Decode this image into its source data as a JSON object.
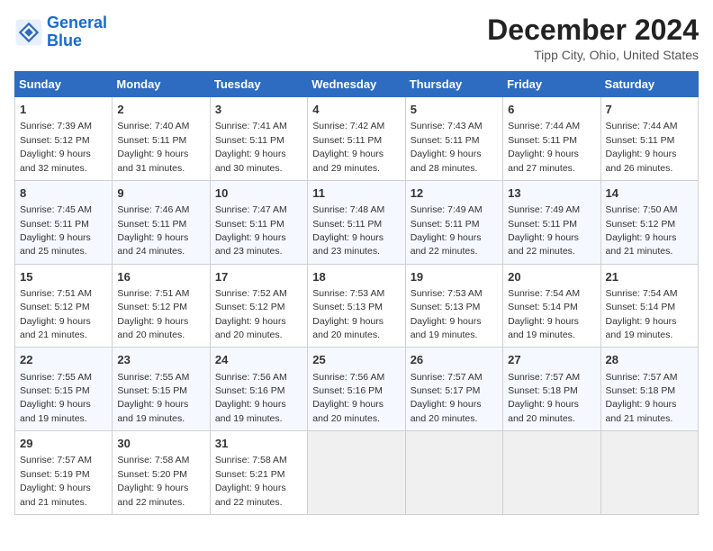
{
  "header": {
    "logo_line1": "General",
    "logo_line2": "Blue",
    "title": "December 2024",
    "subtitle": "Tipp City, Ohio, United States"
  },
  "days_of_week": [
    "Sunday",
    "Monday",
    "Tuesday",
    "Wednesday",
    "Thursday",
    "Friday",
    "Saturday"
  ],
  "weeks": [
    [
      {
        "day": "1",
        "sunrise": "7:39 AM",
        "sunset": "5:12 PM",
        "daylight": "9 hours and 32 minutes."
      },
      {
        "day": "2",
        "sunrise": "7:40 AM",
        "sunset": "5:11 PM",
        "daylight": "9 hours and 31 minutes."
      },
      {
        "day": "3",
        "sunrise": "7:41 AM",
        "sunset": "5:11 PM",
        "daylight": "9 hours and 30 minutes."
      },
      {
        "day": "4",
        "sunrise": "7:42 AM",
        "sunset": "5:11 PM",
        "daylight": "9 hours and 29 minutes."
      },
      {
        "day": "5",
        "sunrise": "7:43 AM",
        "sunset": "5:11 PM",
        "daylight": "9 hours and 28 minutes."
      },
      {
        "day": "6",
        "sunrise": "7:44 AM",
        "sunset": "5:11 PM",
        "daylight": "9 hours and 27 minutes."
      },
      {
        "day": "7",
        "sunrise": "7:44 AM",
        "sunset": "5:11 PM",
        "daylight": "9 hours and 26 minutes."
      }
    ],
    [
      {
        "day": "8",
        "sunrise": "7:45 AM",
        "sunset": "5:11 PM",
        "daylight": "9 hours and 25 minutes."
      },
      {
        "day": "9",
        "sunrise": "7:46 AM",
        "sunset": "5:11 PM",
        "daylight": "9 hours and 24 minutes."
      },
      {
        "day": "10",
        "sunrise": "7:47 AM",
        "sunset": "5:11 PM",
        "daylight": "9 hours and 23 minutes."
      },
      {
        "day": "11",
        "sunrise": "7:48 AM",
        "sunset": "5:11 PM",
        "daylight": "9 hours and 23 minutes."
      },
      {
        "day": "12",
        "sunrise": "7:49 AM",
        "sunset": "5:11 PM",
        "daylight": "9 hours and 22 minutes."
      },
      {
        "day": "13",
        "sunrise": "7:49 AM",
        "sunset": "5:11 PM",
        "daylight": "9 hours and 22 minutes."
      },
      {
        "day": "14",
        "sunrise": "7:50 AM",
        "sunset": "5:12 PM",
        "daylight": "9 hours and 21 minutes."
      }
    ],
    [
      {
        "day": "15",
        "sunrise": "7:51 AM",
        "sunset": "5:12 PM",
        "daylight": "9 hours and 21 minutes."
      },
      {
        "day": "16",
        "sunrise": "7:51 AM",
        "sunset": "5:12 PM",
        "daylight": "9 hours and 20 minutes."
      },
      {
        "day": "17",
        "sunrise": "7:52 AM",
        "sunset": "5:12 PM",
        "daylight": "9 hours and 20 minutes."
      },
      {
        "day": "18",
        "sunrise": "7:53 AM",
        "sunset": "5:13 PM",
        "daylight": "9 hours and 20 minutes."
      },
      {
        "day": "19",
        "sunrise": "7:53 AM",
        "sunset": "5:13 PM",
        "daylight": "9 hours and 19 minutes."
      },
      {
        "day": "20",
        "sunrise": "7:54 AM",
        "sunset": "5:14 PM",
        "daylight": "9 hours and 19 minutes."
      },
      {
        "day": "21",
        "sunrise": "7:54 AM",
        "sunset": "5:14 PM",
        "daylight": "9 hours and 19 minutes."
      }
    ],
    [
      {
        "day": "22",
        "sunrise": "7:55 AM",
        "sunset": "5:15 PM",
        "daylight": "9 hours and 19 minutes."
      },
      {
        "day": "23",
        "sunrise": "7:55 AM",
        "sunset": "5:15 PM",
        "daylight": "9 hours and 19 minutes."
      },
      {
        "day": "24",
        "sunrise": "7:56 AM",
        "sunset": "5:16 PM",
        "daylight": "9 hours and 19 minutes."
      },
      {
        "day": "25",
        "sunrise": "7:56 AM",
        "sunset": "5:16 PM",
        "daylight": "9 hours and 20 minutes."
      },
      {
        "day": "26",
        "sunrise": "7:57 AM",
        "sunset": "5:17 PM",
        "daylight": "9 hours and 20 minutes."
      },
      {
        "day": "27",
        "sunrise": "7:57 AM",
        "sunset": "5:18 PM",
        "daylight": "9 hours and 20 minutes."
      },
      {
        "day": "28",
        "sunrise": "7:57 AM",
        "sunset": "5:18 PM",
        "daylight": "9 hours and 21 minutes."
      }
    ],
    [
      {
        "day": "29",
        "sunrise": "7:57 AM",
        "sunset": "5:19 PM",
        "daylight": "9 hours and 21 minutes."
      },
      {
        "day": "30",
        "sunrise": "7:58 AM",
        "sunset": "5:20 PM",
        "daylight": "9 hours and 22 minutes."
      },
      {
        "day": "31",
        "sunrise": "7:58 AM",
        "sunset": "5:21 PM",
        "daylight": "9 hours and 22 minutes."
      },
      null,
      null,
      null,
      null
    ]
  ]
}
